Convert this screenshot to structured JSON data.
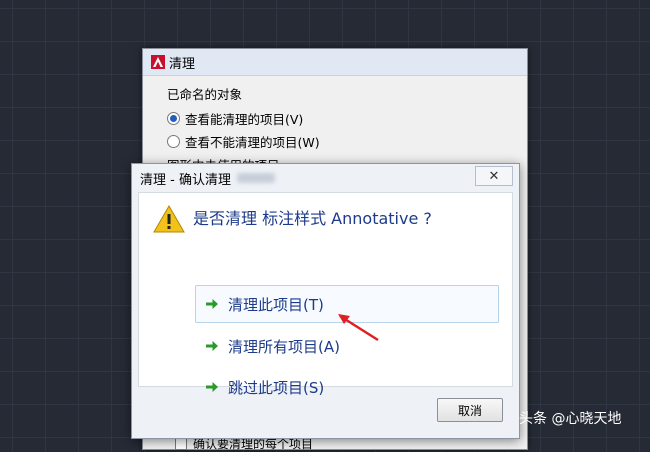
{
  "background_dialog": {
    "title": "清理",
    "group_label": "已命名的对象",
    "radio_1": "查看能清理的项目(V)",
    "radio_2": "查看不能清理的项目(W)",
    "section_label": "图形中未使用的项目:",
    "bottom_option": "确认要清理的每个项目"
  },
  "confirm_dialog": {
    "title": "清理 - 确认清理",
    "close_glyph": "✕",
    "question": "是否清理 标注样式 Annotative ?",
    "options": [
      {
        "label": "清理此项目(T)"
      },
      {
        "label": "清理所有项目(A)"
      },
      {
        "label": "跳过此项目(S)"
      }
    ],
    "cancel_label": "取消"
  },
  "watermark": "头条 @心晓天地",
  "colors": {
    "accent": "#1d3b8a",
    "arrow_green": "#2a9a2a",
    "annotation_red": "#e02020"
  },
  "icons": {
    "app": "autocad-app-icon",
    "warning": "warning-icon",
    "option": "green-arrow-icon"
  }
}
